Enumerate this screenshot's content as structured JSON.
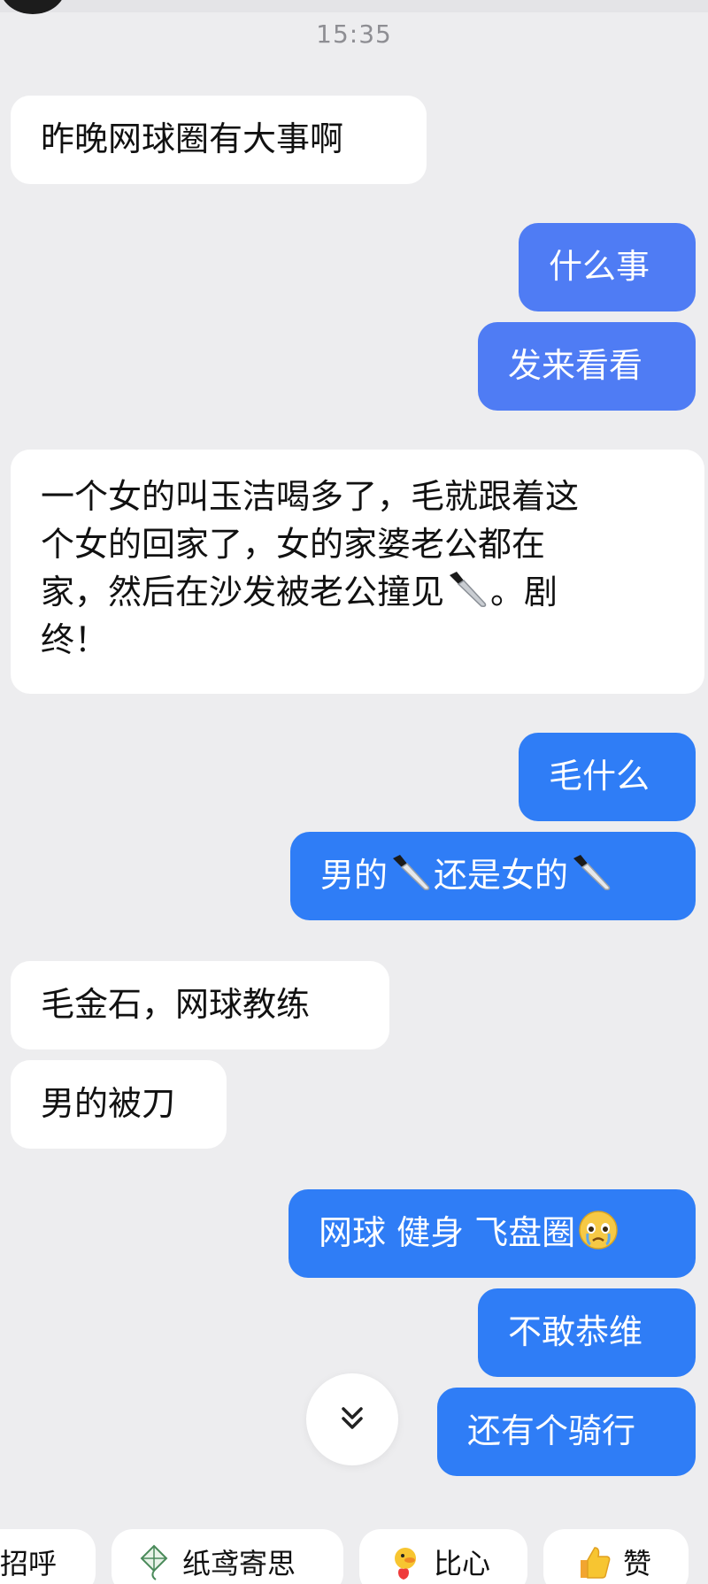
{
  "timestamp": "15:35",
  "messages": [
    {
      "side": "in",
      "text": "昨晚网球圈有大事啊"
    },
    {
      "side": "out",
      "text": "什么事"
    },
    {
      "side": "out",
      "text": "发来看看"
    },
    {
      "side": "in",
      "line1": "一个女的叫玉洁喝多了，毛就跟着这",
      "line2": "个女的回家了，女的家婆老公都在",
      "line3a": "家，然后在沙发被老公撞见",
      "line3b": "。剧",
      "line4": "终！"
    },
    {
      "side": "out",
      "text": "毛什么"
    },
    {
      "side": "out",
      "part1": "男的",
      "part2": "还是女的"
    },
    {
      "side": "in",
      "text": "毛金石，网球教练"
    },
    {
      "side": "in",
      "text": "男的被刀"
    },
    {
      "side": "out",
      "text": "网球 健身 飞盘圈"
    },
    {
      "side": "out",
      "text": "不敢恭维"
    },
    {
      "side": "out",
      "text": "还有个骑行"
    }
  ],
  "quick_replies": [
    {
      "label": "打招呼",
      "visible_label": "招呼"
    },
    {
      "label": "纸鸢寄思",
      "icon": "kite-icon"
    },
    {
      "label": "比心",
      "icon": "duck-heart-icon"
    },
    {
      "label": "赞",
      "icon": "thumbs-up-icon"
    }
  ],
  "colors": {
    "background": "#ededef",
    "incoming_bubble": "#ffffff",
    "outgoing_bubble_a": "#4f7cf4",
    "outgoing_bubble_b": "#2f7df6"
  },
  "icons": {
    "knife": "knife-emoji-icon",
    "cry": "crying-face-icon",
    "scroll": "double-chevron-down-icon"
  }
}
